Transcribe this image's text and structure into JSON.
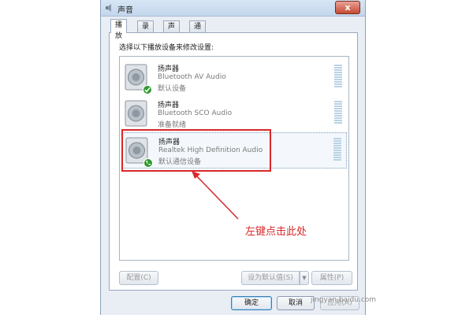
{
  "window": {
    "title": "声音",
    "close_label": "x"
  },
  "tabs": [
    {
      "label": "播放",
      "active": true
    },
    {
      "label": "录制",
      "active": false
    },
    {
      "label": "声音",
      "active": false
    },
    {
      "label": "通信",
      "active": false
    }
  ],
  "instruction": "选择以下播放设备来修改设置:",
  "devices": [
    {
      "name": "扬声器",
      "description": "Bluetooth AV Audio",
      "status": "默认设备",
      "status_icon": "check-icon",
      "badge_color": "#2f9a2f",
      "selected": false
    },
    {
      "name": "扬声器",
      "description": "Bluetooth SCO Audio",
      "status": "准备就绪",
      "status_icon": "none",
      "badge_color": "",
      "selected": false
    },
    {
      "name": "扬声器",
      "description": "Realtek High Definition Audio",
      "status": "默认通信设备",
      "status_icon": "phone-icon",
      "badge_color": "#2f9a2f",
      "selected": true
    }
  ],
  "annotation": {
    "text": "左键点击此处",
    "color": "#d8282a"
  },
  "buttons": {
    "configure": "配置(C)",
    "set_default": "设为默认值(S)",
    "properties": "属性(P)",
    "ok": "确定",
    "cancel": "取消",
    "apply": "应用(A)"
  },
  "watermark": "jingyan.baidu.com"
}
